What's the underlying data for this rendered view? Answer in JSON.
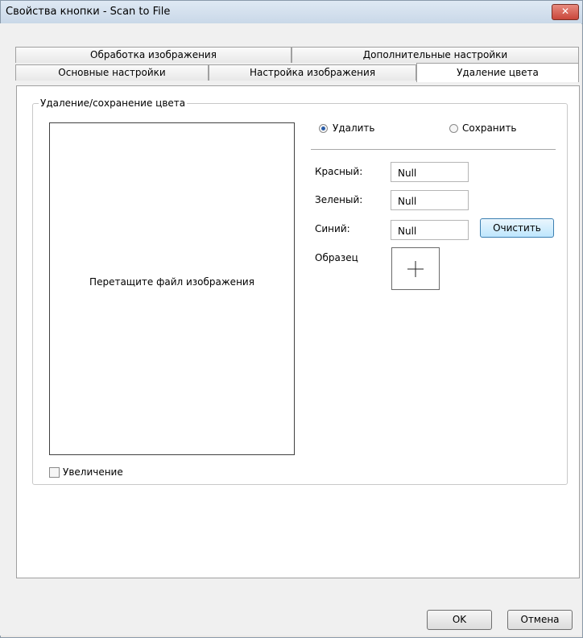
{
  "window": {
    "title": "Свойства кнопки - Scan to File",
    "close_label": "✕"
  },
  "tabs": {
    "row1": [
      "Обработка изображения",
      "Дополнительные настройки"
    ],
    "row2": [
      "Основные настройки",
      "Настройка изображения",
      "Удаление цвета"
    ],
    "active": "Удаление цвета"
  },
  "group": {
    "label": "Удаление/сохранение цвета"
  },
  "dropzone": {
    "text": "Перетащите файл изображения"
  },
  "mode": {
    "remove_label": "Удалить",
    "keep_label": "Сохранить",
    "selected": "Удалить"
  },
  "fields": {
    "red_label": "Красный:",
    "red_value": "Null",
    "green_label": "Зеленый:",
    "green_value": "Null",
    "blue_label": "Синий:",
    "blue_value": "Null"
  },
  "clear_button": "Очистить",
  "sample_label": "Образец",
  "sample_icon": "crosshair-icon",
  "zoom": {
    "label": "Увеличение",
    "checked": false
  },
  "footer": {
    "ok": "OK",
    "cancel": "Отмена"
  }
}
